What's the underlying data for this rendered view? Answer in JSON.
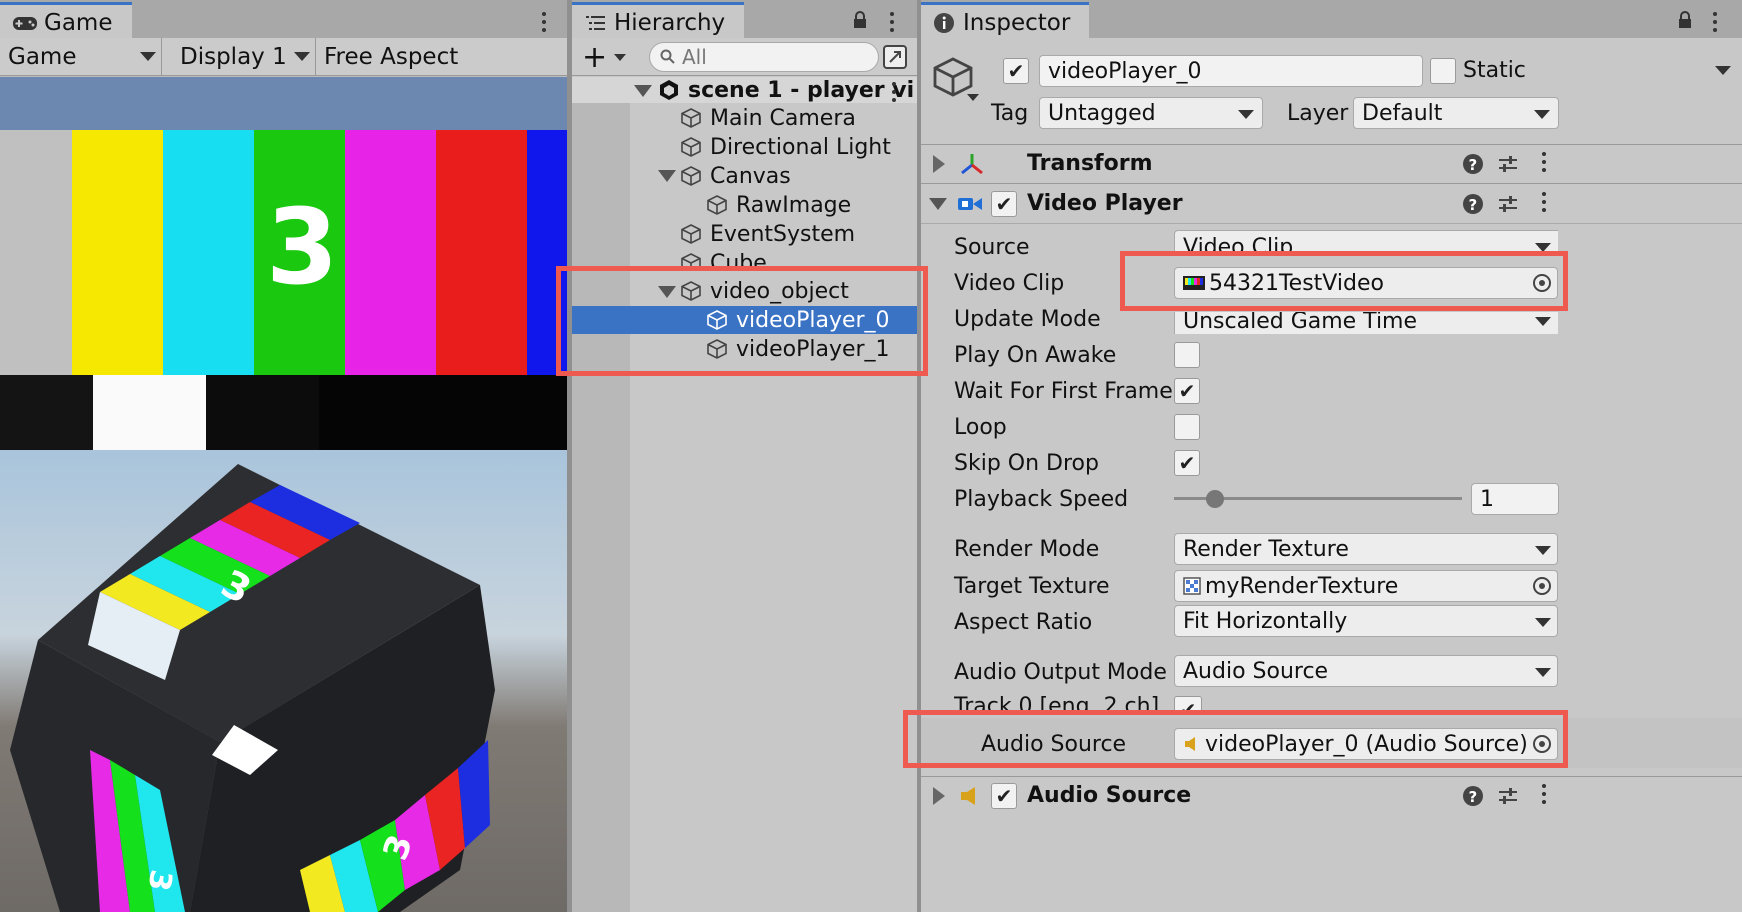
{
  "game": {
    "tab_label": "Game",
    "mode_dropdown": "Game",
    "display_dropdown": "Display 1",
    "aspect_dropdown": "Free Aspect",
    "bar_number": "3",
    "cube_number_top": "3",
    "cube_number_side": "3",
    "cube_number_front": "3"
  },
  "hierarchy": {
    "tab_label": "Hierarchy",
    "add_label": "+",
    "search_placeholder": "All",
    "scene_name": "scene 1 - player vi",
    "items": [
      {
        "label": "Main Camera"
      },
      {
        "label": "Directional Light"
      },
      {
        "label": "Canvas"
      },
      {
        "label": "RawImage"
      },
      {
        "label": "EventSystem"
      },
      {
        "label": "Cube"
      },
      {
        "label": "video_object"
      },
      {
        "label": "videoPlayer_0"
      },
      {
        "label": "videoPlayer_1"
      }
    ],
    "selected_item": "videoPlayer_0"
  },
  "inspector": {
    "tab_label": "Inspector",
    "object_name": "videoPlayer_0",
    "static_label": "Static",
    "tag_label": "Tag",
    "tag_value": "Untagged",
    "layer_label": "Layer",
    "layer_value": "Default",
    "components": {
      "transform": "Transform",
      "video_player": "Video Player",
      "audio_source": "Audio Source"
    },
    "fields": {
      "source": {
        "label": "Source",
        "value": "Video Clip"
      },
      "video_clip": {
        "label": "Video Clip",
        "value": "54321TestVideo"
      },
      "update_mode": {
        "label": "Update Mode",
        "value": "Unscaled Game Time"
      },
      "play_on_awake": {
        "label": "Play On Awake",
        "checked": false
      },
      "wait_first_frame": {
        "label": "Wait For First Frame",
        "checked": true
      },
      "loop": {
        "label": "Loop",
        "checked": false
      },
      "skip_on_drop": {
        "label": "Skip On Drop",
        "checked": true
      },
      "playback_speed": {
        "label": "Playback Speed",
        "value": "1",
        "slider_fraction": 0.12
      },
      "render_mode": {
        "label": "Render Mode",
        "value": "Render Texture"
      },
      "target_texture": {
        "label": "Target Texture",
        "value": "myRenderTexture"
      },
      "aspect_ratio": {
        "label": "Aspect Ratio",
        "value": "Fit Horizontally"
      },
      "audio_output_mode": {
        "label": "Audio Output Mode",
        "value": "Audio Source"
      },
      "track": {
        "label": "Track 0 [eng, 2 ch]",
        "checked": true
      },
      "audio_source": {
        "label": "Audio Source",
        "value": "videoPlayer_0 (Audio Source)"
      }
    }
  },
  "colors": {
    "highlight_red": "#ee5a4f",
    "selection_blue": "#3a72c4",
    "panel_bg": "#c8c8c8"
  }
}
